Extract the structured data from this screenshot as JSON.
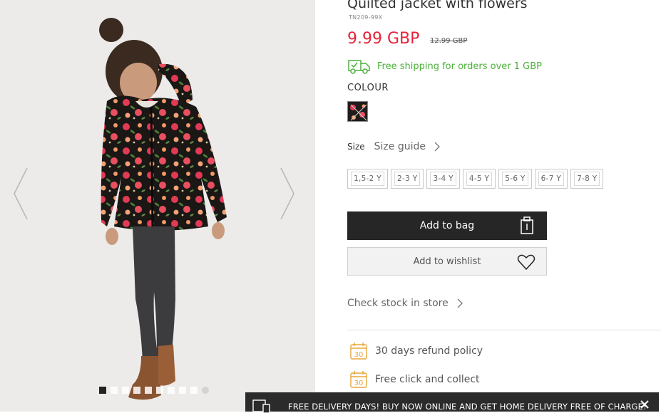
{
  "product": {
    "title": "Quilted jacket with flowers",
    "sku": "TN209-99X",
    "price": "9.99 GBP",
    "old_price": "12.99 GBP",
    "shipping_text": "Free shipping for orders over 1 GBP",
    "colour_label": "COLOUR",
    "size_label": "Size",
    "size_guide": "Size guide",
    "sizes": [
      "1,5-2 Y",
      "2-3 Y",
      "3-4 Y",
      "4-5 Y",
      "5-6 Y",
      "6-7 Y",
      "7-8 Y"
    ],
    "add_to_bag": "Add to bag",
    "add_to_wishlist": "Add to wishlist",
    "check_stock": "Check stock in store",
    "perks": [
      {
        "icon": "calendar-icon",
        "number": "30",
        "text": "30 days refund policy"
      },
      {
        "icon": "calendar-icon",
        "number": "30",
        "text": "Free click and collect"
      }
    ]
  },
  "gallery": {
    "image_count": 10,
    "active_index": 0
  },
  "banner": {
    "text": "FREE DELIVERY DAYS! BUY NOW ONLINE AND GET HOME DELIVERY FREE OF CHARGE!"
  },
  "colors": {
    "price": "#e5243b",
    "shipping": "#4caf3a",
    "button_dark": "#262626",
    "calendar_accent": "#e7a53a"
  }
}
